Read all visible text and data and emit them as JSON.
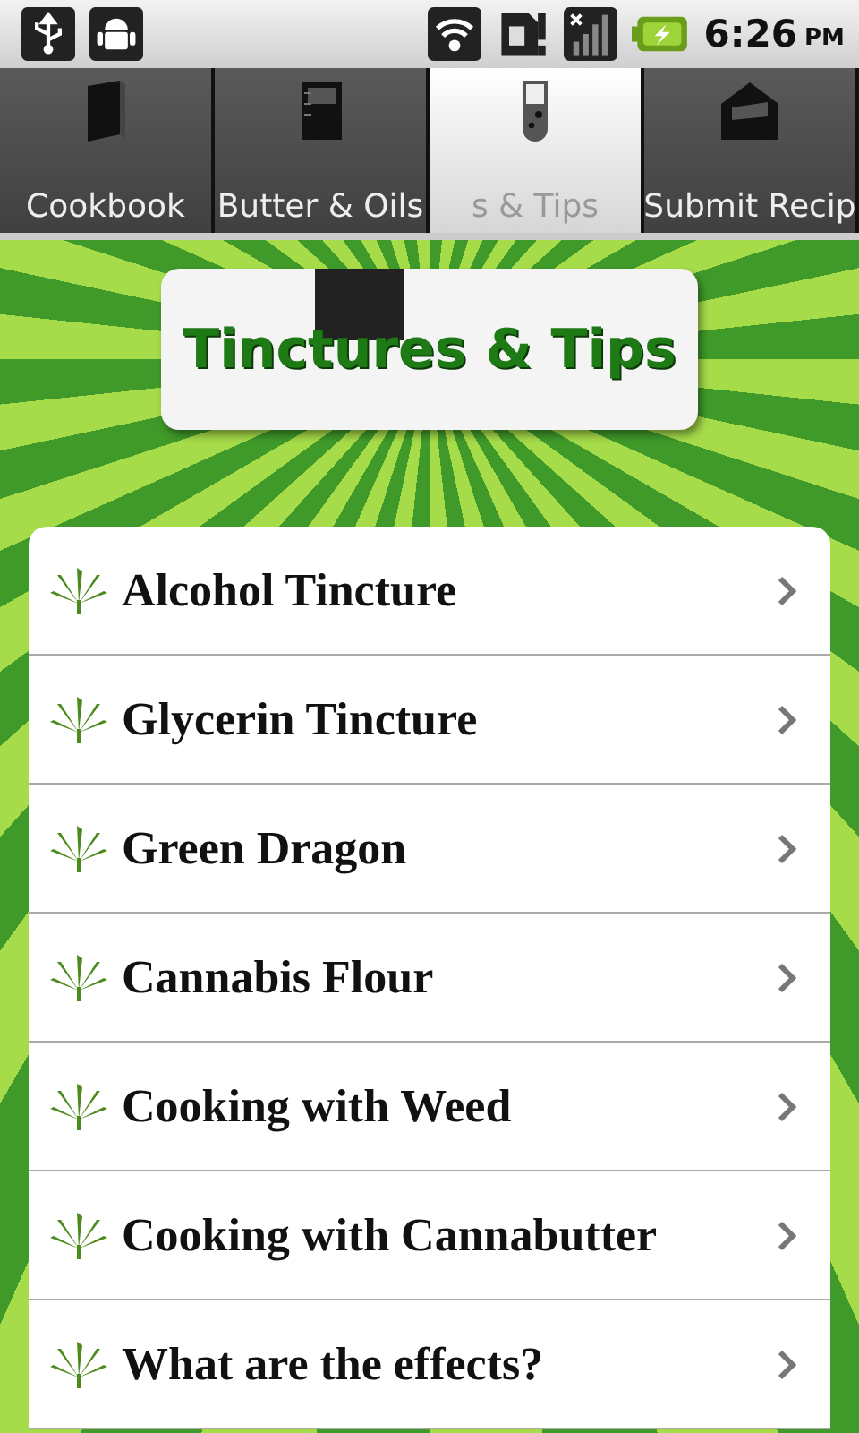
{
  "status_bar": {
    "time": "6:26",
    "ampm": "PM"
  },
  "tabs": [
    {
      "label": "Cookbook",
      "kind": "book",
      "selected": false
    },
    {
      "label": "Butter & Oils",
      "kind": "beaker",
      "selected": false
    },
    {
      "label": "s & Tips",
      "kind": "tube",
      "selected": true
    },
    {
      "label": "Submit Recip",
      "kind": "envelope",
      "selected": false
    }
  ],
  "banner": {
    "title": "Tinctures & Tips"
  },
  "items": [
    {
      "label": "Alcohol Tincture"
    },
    {
      "label": "Glycerin Tincture"
    },
    {
      "label": "Green Dragon"
    },
    {
      "label": "Cannabis Flour"
    },
    {
      "label": "Cooking with Weed"
    },
    {
      "label": "Cooking with Cannabutter"
    },
    {
      "label": "What are the effects?"
    }
  ]
}
